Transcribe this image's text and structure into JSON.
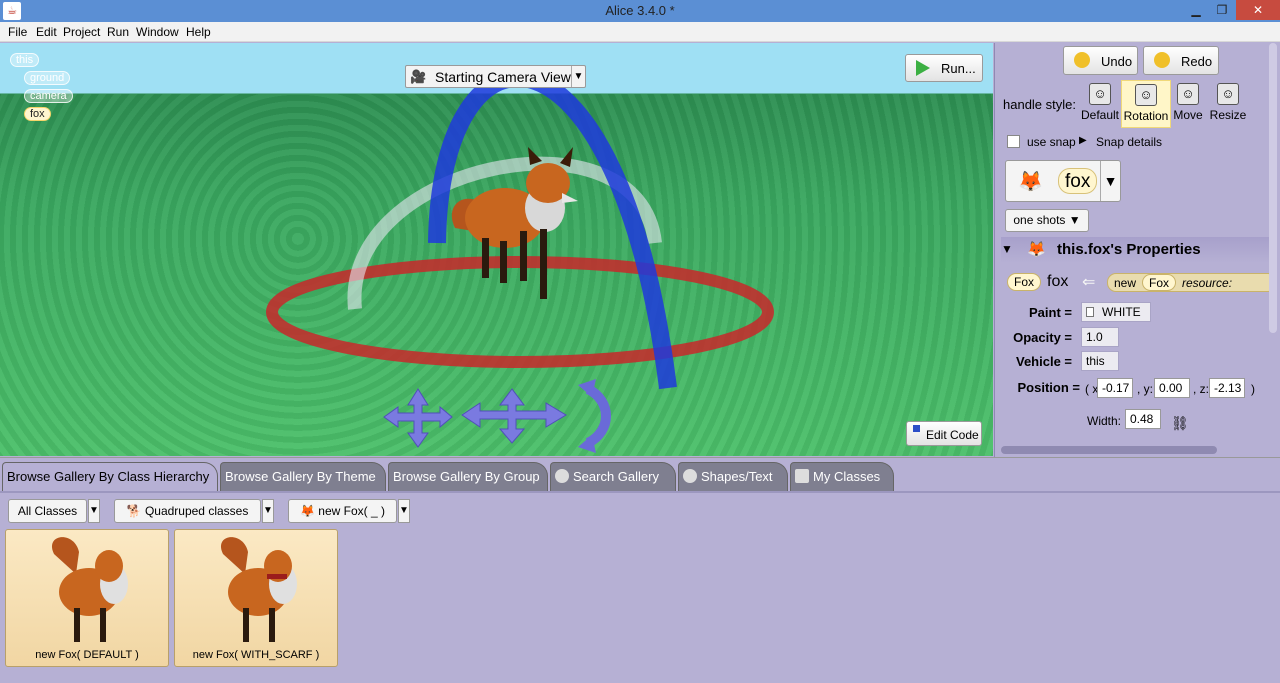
{
  "window": {
    "title": "Alice 3.4.0  *",
    "controls": [
      "minimize",
      "maximize",
      "close"
    ]
  },
  "menu": [
    "File",
    "Edit",
    "Project",
    "Run",
    "Window",
    "Help"
  ],
  "scene": {
    "tree": [
      "this",
      "ground",
      "camera",
      "fox"
    ],
    "camera_view": "Starting Camera View",
    "run_label": "Run...",
    "edit_code_label": "Edit Code",
    "colors": {
      "sky": "#9fe0f4",
      "ground": "#3aa860",
      "ring": "#c8282a",
      "arch_blue": "#1e3adc",
      "arch_white": "#e6e6f0"
    }
  },
  "panel": {
    "undo_label": "Undo",
    "redo_label": "Redo",
    "handle_style_label": "handle style:",
    "handle_styles": [
      "Default",
      "Rotation",
      "Move",
      "Resize"
    ],
    "handle_style_selected": "Rotation",
    "use_snap_label": "use snap",
    "use_snap_checked": false,
    "snap_details_label": "Snap details",
    "selected_object": "fox",
    "one_shots_label": "one shots",
    "properties_title": "this.fox's Properties",
    "type_chip": "Fox",
    "name": "fox",
    "new_text": "new",
    "new_type": "Fox",
    "resource_text": "resource:",
    "paint_label": "Paint =",
    "paint_value": "WHITE",
    "opacity_label": "Opacity =",
    "opacity_value": "1.0",
    "vehicle_label": "Vehicle =",
    "vehicle_value": "this",
    "position_label": "Position =",
    "position": {
      "x_label": "( x:",
      "x": "-0.17",
      "y_label": ", y:",
      "y": "0.00",
      "z_label": ", z:",
      "z": "-2.13",
      "close": ")"
    },
    "width_label": "Width:",
    "width_value": "0.48"
  },
  "gallery": {
    "tabs": [
      "Browse Gallery By Class Hierarchy",
      "Browse Gallery By Theme",
      "Browse Gallery By Group",
      "Search Gallery",
      "Shapes/Text",
      "My Classes"
    ],
    "active_tab": "Browse Gallery By Class Hierarchy",
    "crumbs": [
      "All Classes",
      "Quadruped classes",
      "new Fox( _ )"
    ],
    "cards": [
      "new Fox( DEFAULT )",
      "new Fox( WITH_SCARF )"
    ]
  }
}
